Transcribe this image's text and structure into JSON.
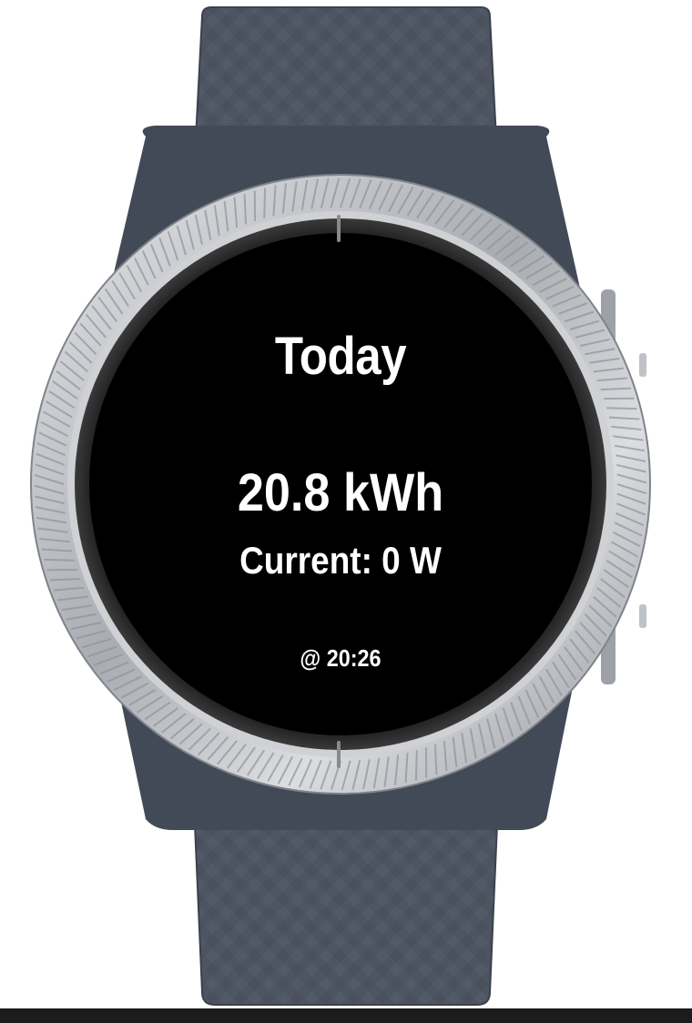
{
  "watch_screen": {
    "title": "Today",
    "energy_today": "20.8 kWh",
    "current_power": "Current: 0 W",
    "updated_at": "@ 20:26"
  },
  "colors": {
    "strap": "#4e5562",
    "strap_dark": "#3f4552",
    "bezel": "#c2c4c8",
    "screen_bg": "#000000",
    "text": "#ffffff",
    "marker": "#8a8a8a"
  },
  "icons": [
    "watch-strap",
    "bezel-ring",
    "side-button"
  ]
}
